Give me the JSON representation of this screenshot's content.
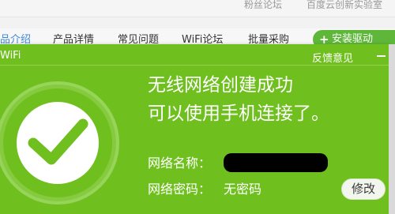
{
  "background_page": {
    "top_links": [
      "粉丝论坛",
      "百度云创新实验室"
    ],
    "nav_items": [
      "产品介绍",
      "产品详情",
      "常见问题",
      "WiFi论坛",
      "批量采购"
    ],
    "install_button": "安装驱动"
  },
  "popup": {
    "title": "WiFi",
    "feedback_link": "反馈意见",
    "message_line1": "无线网络创建成功",
    "message_line2": "可以使用手机连接了。",
    "network_name_label": "网络名称：",
    "network_password_label": "网络密码：",
    "network_password_value": "无密码",
    "edit_button": "修改"
  },
  "colors": {
    "popup_green": "#6fc01f",
    "accent_blue": "#3b86d8",
    "install_green": "#5fb73a"
  },
  "icons": [
    "check-icon",
    "minimize-icon",
    "plus-icon"
  ]
}
